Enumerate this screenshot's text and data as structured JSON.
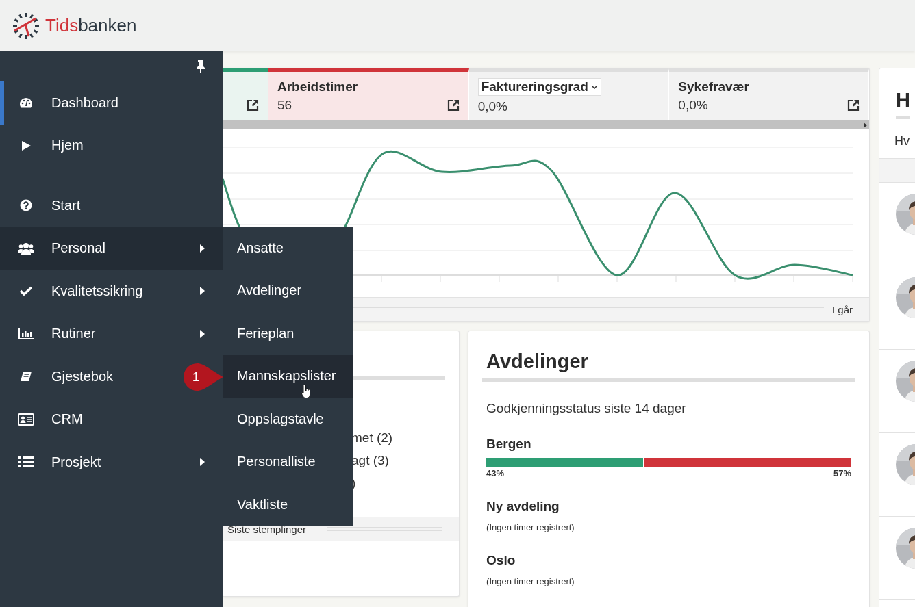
{
  "header": {
    "logo_part1": "Tids",
    "logo_part2": "banken"
  },
  "sidebar": {
    "groups": [
      [
        {
          "label": "Dashboard",
          "selected": true,
          "expanded": false,
          "submenu": false
        },
        {
          "label": "Hjem",
          "selected": false,
          "expanded": false,
          "submenu": false
        }
      ],
      [
        {
          "label": "Start",
          "selected": false,
          "expanded": false,
          "submenu": false
        },
        {
          "label": "Personal",
          "selected": false,
          "expanded": true,
          "submenu": true
        },
        {
          "label": "Kvalitetssikring",
          "selected": false,
          "expanded": false,
          "submenu": true
        },
        {
          "label": "Rutiner",
          "selected": false,
          "expanded": false,
          "submenu": true
        },
        {
          "label": "Gjestebok",
          "selected": false,
          "expanded": false
        },
        {
          "label": "CRM",
          "selected": false,
          "expanded": false,
          "submenu": false
        },
        {
          "label": "Prosjekt",
          "selected": false,
          "expanded": false,
          "submenu": true
        }
      ]
    ]
  },
  "submenu": {
    "items": [
      {
        "label": "Ansatte",
        "selected": false
      },
      {
        "label": "Avdelinger",
        "selected": false
      },
      {
        "label": "Ferieplan",
        "selected": false
      },
      {
        "label": "Mannskapslister",
        "selected": true
      },
      {
        "label": "Oppslagstavle",
        "selected": false
      },
      {
        "label": "Personalliste",
        "selected": false
      },
      {
        "label": "Vaktliste",
        "selected": false
      }
    ]
  },
  "callout": {
    "number": "1"
  },
  "metric_tabs": [
    {
      "kind": "partial",
      "color": "#2e9e74"
    },
    {
      "kind": "metric",
      "title": "Arbeidstimer",
      "value": "56",
      "color": "#d0343a"
    },
    {
      "kind": "dropdown",
      "title": "Faktureringsgrad",
      "value": "0,0%",
      "color": "#dedede"
    },
    {
      "kind": "metric",
      "title": "Sykefravær",
      "value": "0,0%",
      "color": "#dedede"
    }
  ],
  "chart_footer": "I går",
  "stamp_card": {
    "lines": [
      "met (2)",
      "agt (3)",
      ")"
    ],
    "footer": "Siste stemplinger"
  },
  "departments": {
    "title": "Avdelinger",
    "subtitle": "Godkjenningsstatus siste 14 dager",
    "items": [
      {
        "kind": "bar",
        "name": "Bergen",
        "level": 0.43,
        "left_label": "43%",
        "right_label": "57%"
      },
      {
        "kind": "empty",
        "name": "Ny avdeling",
        "note": "(Ingen timer registrert)"
      },
      {
        "kind": "empty",
        "name": "Oslo",
        "note": "(Ingen timer registrert)"
      }
    ]
  },
  "right_panel": {
    "title": "H",
    "text": "Hv"
  }
}
